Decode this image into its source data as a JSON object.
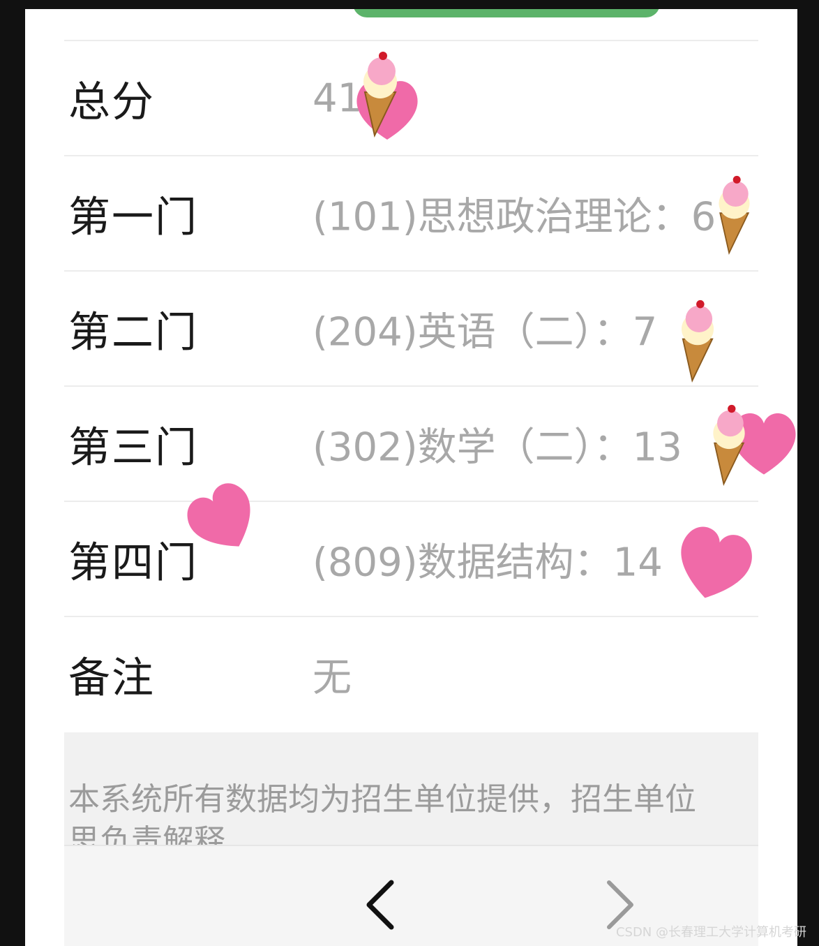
{
  "rows": [
    {
      "label": "总分",
      "value": "41"
    },
    {
      "label": "第一门",
      "value": "(101)思想政治理论：6"
    },
    {
      "label": "第二门",
      "value": "(204)英语（二）：7"
    },
    {
      "label": "第三门",
      "value": "(302)数学（二）：13"
    },
    {
      "label": "第四门",
      "value": "(809)数据结构：14"
    },
    {
      "label": "备注",
      "value": "无"
    }
  ],
  "notice": {
    "line1": "本系统所有数据均为招生单位提供，招生单位",
    "line2": "思负责解释"
  },
  "nav": {
    "prev_icon": "chevron-left-icon",
    "next_icon": "chevron-right-icon"
  },
  "watermark": "CSDN @长春理工大学计算机考研",
  "colors": {
    "accent_green": "#5cb36a",
    "sticker_pink": "#f06aa8"
  }
}
